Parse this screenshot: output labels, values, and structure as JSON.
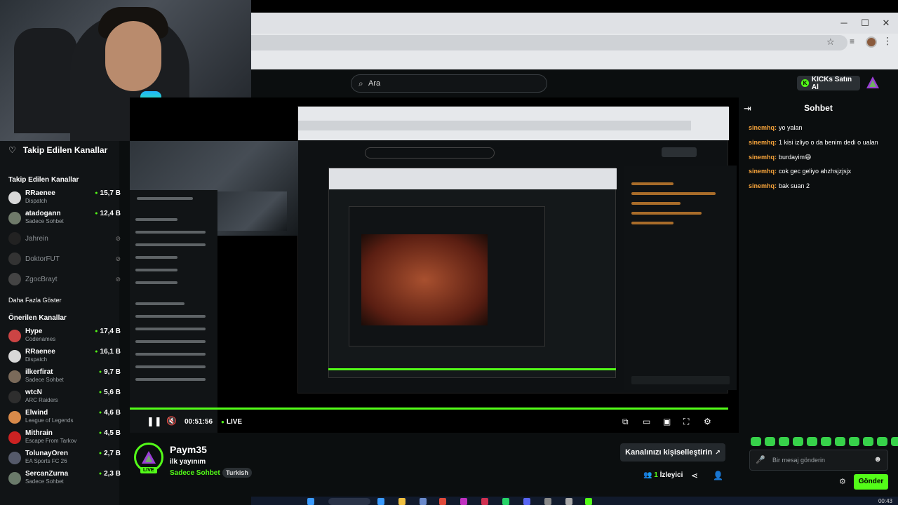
{
  "header": {
    "search_placeholder": "Ara",
    "kicks_button": "KICKs Satın Al",
    "kicks_icon": "K"
  },
  "sidebar": {
    "heading": "Takip Edilen Kanallar",
    "followed_title": "Takip Edilen Kanallar",
    "followed": [
      {
        "name": "RRaenee",
        "sub": "Dispatch",
        "viewers": "15,7 B"
      },
      {
        "name": "atadogann",
        "sub": "Sadece Sohbet",
        "viewers": "12,4 B"
      },
      {
        "name": "Jahrein",
        "sub": "",
        "viewers": ""
      },
      {
        "name": "DoktorFUT",
        "sub": "",
        "viewers": ""
      },
      {
        "name": "ZgocBrayt",
        "sub": "",
        "viewers": ""
      }
    ],
    "more_label": "Daha Fazla Göster",
    "recommended_title": "Önerilen Kanallar",
    "recommended": [
      {
        "name": "Hype",
        "sub": "Codenames",
        "viewers": "17,4 B"
      },
      {
        "name": "RRaenee",
        "sub": "Dispatch",
        "viewers": "16,1 B"
      },
      {
        "name": "ilkerfirat",
        "sub": "Sadece Sohbet",
        "viewers": "9,7 B"
      },
      {
        "name": "wtcN",
        "sub": "ARC Raiders",
        "viewers": "5,6 B"
      },
      {
        "name": "Elwind",
        "sub": "League of Legends",
        "viewers": "4,6 B"
      },
      {
        "name": "Mithrain",
        "sub": "Escape From Tarkov",
        "viewers": "4,5 B"
      },
      {
        "name": "TolunayOren",
        "sub": "EA Sports FC 26",
        "viewers": "2,7 B"
      },
      {
        "name": "SercanZurna",
        "sub": "Sadece Sohbet",
        "viewers": "2,3 B"
      }
    ]
  },
  "player": {
    "time": "00:51:56",
    "live_label": "LIVE"
  },
  "stream": {
    "channel": "Paym35",
    "title": "ilk yayınım",
    "category": "Sadece Sohbet",
    "tag": "Turkish",
    "live_badge": "LIVE",
    "customize_label": "Kanalınızı kişiselleştirin",
    "viewer_count": "1",
    "viewer_label": "İzleyici"
  },
  "chat": {
    "title": "Sohbet",
    "messages": [
      {
        "user": "sinemhq:",
        "text": "yo yalan"
      },
      {
        "user": "sinemhq:",
        "text": "1 kisi izliyo o da benim dedi o ualan"
      },
      {
        "user": "sinemhq:",
        "text": "burdayim😄"
      },
      {
        "user": "sinemhq:",
        "text": "cok gec geliyo ahzhsjzjsjx"
      },
      {
        "user": "sinemhq:",
        "text": "bak suan 2"
      }
    ],
    "input_placeholder": "Bir mesaj gönderin",
    "send_label": "Gönder"
  },
  "taskbar": {
    "clock": "00:43"
  },
  "colors": {
    "accent": "#53fc18",
    "username": "#f7a43b",
    "background": "#0b0e0f"
  }
}
